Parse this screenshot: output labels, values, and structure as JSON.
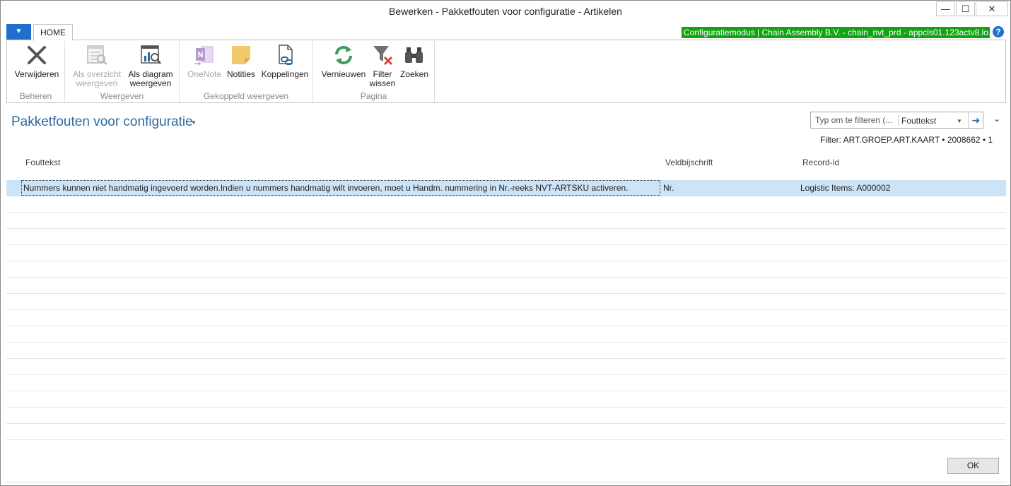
{
  "window": {
    "title": "Bewerken - Pakketfouten voor configuratie - Artikelen",
    "min_glyph": "—",
    "max_glyph": "☐",
    "close_glyph": "✕"
  },
  "ribbon": {
    "app_menu_glyph": "▼",
    "tab_home": "HOME",
    "context_bar": "Configuratiemodus | Chain Assembly B.V. - chain_nvt_prd - appcls01.123actv8.lo...",
    "help_glyph": "?",
    "groups": {
      "beheren": "Beheren",
      "weergeven": "Weergeven",
      "gekoppeld": "Gekoppeld weergeven",
      "pagina": "Pagina"
    },
    "buttons": {
      "verwijderen": "Verwijderen",
      "als_overzicht_1": "Als overzicht",
      "als_overzicht_2": "weergeven",
      "als_diagram_1": "Als diagram",
      "als_diagram_2": "weergeven",
      "onenote": "OneNote",
      "notities": "Notities",
      "koppelingen": "Koppelingen",
      "vernieuwen": "Vernieuwen",
      "filter_1": "Filter",
      "filter_2": "wissen",
      "zoeken": "Zoeken"
    },
    "icons": {
      "verwijderen": "delete-x-icon",
      "als_overzicht": "list-view-icon",
      "als_diagram": "chart-view-icon",
      "onenote": "onenote-icon",
      "notities": "note-icon",
      "koppelingen": "link-icon",
      "vernieuwen": "refresh-icon",
      "filter": "clear-filter-icon",
      "zoeken": "binoculars-icon"
    }
  },
  "page": {
    "title": "Pakketfouten voor configuratie",
    "title_caret": "▼",
    "filter_placeholder": "Typ om te filteren (...",
    "filter_field": "Fouttekst",
    "filter_dd": "▼",
    "filter_go": "➔",
    "collapse_glyph": "⌄",
    "filter_text": "Filter: ART.GROEP.ART.KAART • 2008662 • 1"
  },
  "grid": {
    "columns": [
      "Fouttekst",
      "Veldbijschrift",
      "Record-id"
    ],
    "rows": [
      {
        "fouttekst": "Nummers kunnen niet handmatig ingevoerd worden.Indien u nummers handmatig wilt invoeren, moet u Handm. nummering in Nr.-reeks NVT-ARTSKU activeren.",
        "veldbijschrift": "Nr.",
        "record_id": "Logistic Items: A000002"
      }
    ]
  },
  "footer": {
    "ok_label": "OK"
  },
  "colors": {
    "accent_blue": "#1f6fcf",
    "title_blue": "#2b6aa3",
    "context_green": "#12a312",
    "selected_row": "#cde4f7"
  }
}
